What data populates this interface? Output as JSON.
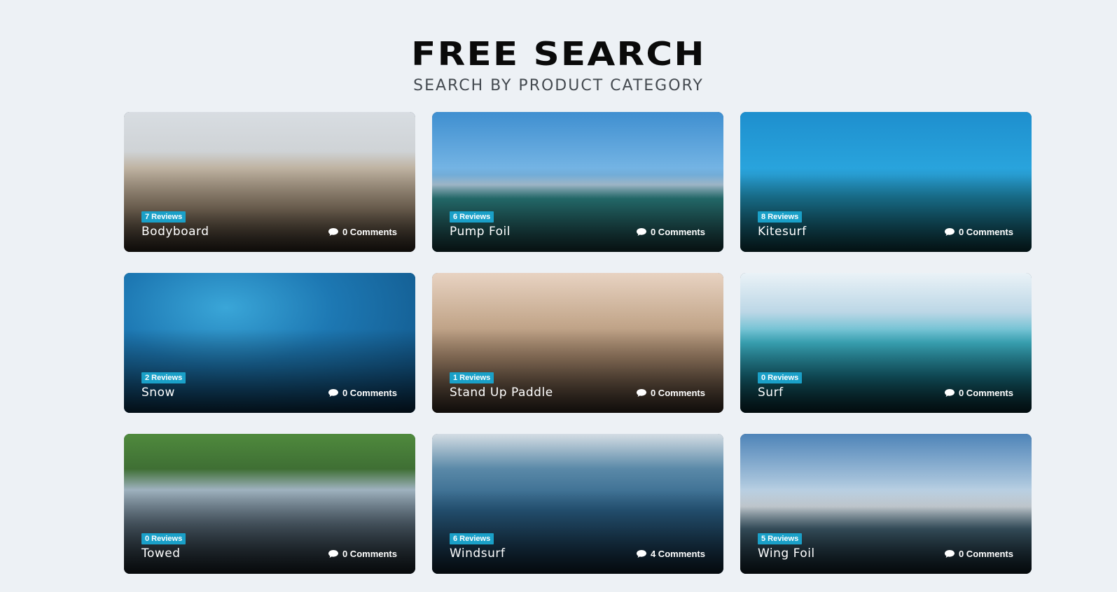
{
  "header": {
    "title": "FREE SEARCH",
    "subtitle": "SEARCH BY PRODUCT CATEGORY"
  },
  "categories": [
    {
      "title": "Bodyboard",
      "reviews": "7 Reviews",
      "comments": "0 Comments",
      "scene": "s-bodyboard"
    },
    {
      "title": "Pump Foil",
      "reviews": "6 Reviews",
      "comments": "0 Comments",
      "scene": "s-pumpfoil"
    },
    {
      "title": "Kitesurf",
      "reviews": "8 Reviews",
      "comments": "0 Comments",
      "scene": "s-kitesurf"
    },
    {
      "title": "Snow",
      "reviews": "2 Reviews",
      "comments": "0 Comments",
      "scene": "s-snow"
    },
    {
      "title": "Stand Up Paddle",
      "reviews": "1 Reviews",
      "comments": "0 Comments",
      "scene": "s-sup"
    },
    {
      "title": "Surf",
      "reviews": "0 Reviews",
      "comments": "0 Comments",
      "scene": "s-surf"
    },
    {
      "title": "Towed",
      "reviews": "0 Reviews",
      "comments": "0 Comments",
      "scene": "s-towed"
    },
    {
      "title": "Windsurf",
      "reviews": "6 Reviews",
      "comments": "4 Comments",
      "scene": "s-windsurf"
    },
    {
      "title": "Wing Foil",
      "reviews": "5 Reviews",
      "comments": "0 Comments",
      "scene": "s-wingfoil"
    }
  ],
  "colors": {
    "page_background": "#edf1f5",
    "badge": "#1aa0c8",
    "title": "#0a0a0a",
    "subtitle": "#444a50"
  },
  "icons": {
    "comment": "speech-bubble-icon"
  }
}
